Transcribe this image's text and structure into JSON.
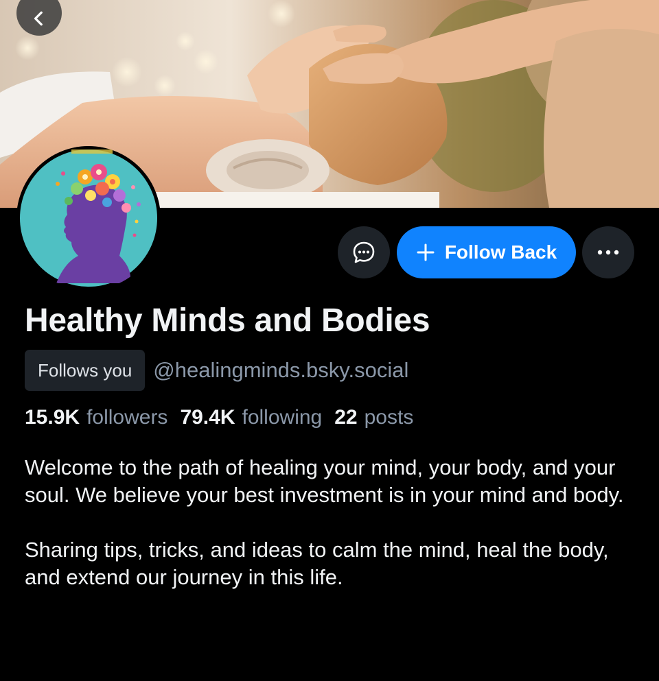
{
  "profile": {
    "display_name": "Healthy Minds and Bodies",
    "follows_you_label": "Follows you",
    "handle": "@healingminds.bsky.social",
    "stats": {
      "followers_count": "15.9K",
      "followers_label": "followers",
      "following_count": "79.4K",
      "following_label": "following",
      "posts_count": "22",
      "posts_label": "posts"
    },
    "bio": {
      "paragraph_1": "Welcome to the path of healing your mind, your body, and your soul.  We believe your best investment is in your mind and body.",
      "paragraph_2": "Sharing tips, tricks, and ideas to calm the mind, heal the body, and extend our journey in this life."
    }
  },
  "actions": {
    "follow_back_label": "Follow Back"
  },
  "icons": {
    "back": "chevron-left-icon",
    "message": "chat-bubble-icon",
    "follow": "plus-icon",
    "more": "ellipsis-icon"
  },
  "colors": {
    "background": "#000000",
    "accent": "#1083fe",
    "button_dark": "#1e2329",
    "muted_text": "#8b98a9"
  }
}
